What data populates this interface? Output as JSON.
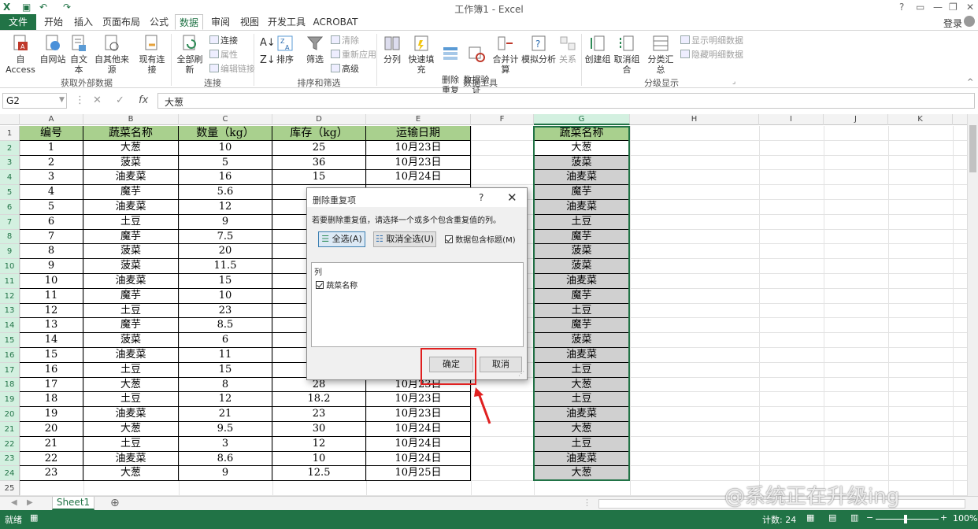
{
  "titlebar": {
    "title": "工作簿1 - Excel",
    "icons": [
      "excel-logo",
      "save-icon",
      "undo-icon",
      "redo-icon"
    ]
  },
  "tabs": {
    "file": "文件",
    "items": [
      "开始",
      "插入",
      "页面布局",
      "公式",
      "数据",
      "审阅",
      "视图",
      "开发工具",
      "ACROBAT"
    ],
    "active": "数据",
    "signin": "登录"
  },
  "ribbon": {
    "external": {
      "buttons": [
        "自 Access",
        "自网站",
        "自文本",
        "自其他来源",
        "现有连接"
      ],
      "group": "获取外部数据"
    },
    "connections": {
      "refresh": "全部刷新",
      "small": [
        "连接",
        "属性",
        "编辑链接"
      ],
      "group": "连接"
    },
    "sortfilter": {
      "sort": "排序",
      "filter": "筛选",
      "small": [
        "清除",
        "重新应用",
        "高级"
      ],
      "group": "排序和筛选"
    },
    "datatools": {
      "buttons": [
        "分列",
        "快速填充",
        "删除\n重复项",
        "数据验\n证",
        "合并计算",
        "模拟分析",
        "关系"
      ],
      "group": "数据工具"
    },
    "outline": {
      "buttons": [
        "创建组",
        "取消组合",
        "分类汇总"
      ],
      "small": [
        "显示明细数据",
        "隐藏明细数据"
      ],
      "group": "分级显示"
    }
  },
  "formula": {
    "namebox": "G2",
    "value": "大葱"
  },
  "columns": [
    "A",
    "B",
    "C",
    "D",
    "E",
    "F",
    "G",
    "H",
    "I",
    "J",
    "K"
  ],
  "table": {
    "headers": [
      "编号",
      "蔬菜名称",
      "数量（kg）",
      "库存（kg）",
      "运输日期"
    ],
    "rows": [
      [
        "1",
        "大葱",
        "10",
        "25",
        "10月23日"
      ],
      [
        "2",
        "菠菜",
        "5",
        "36",
        "10月23日"
      ],
      [
        "3",
        "油麦菜",
        "16",
        "15",
        "10月24日"
      ],
      [
        "4",
        "魔芋",
        "5.6",
        "",
        ""
      ],
      [
        "5",
        "油麦菜",
        "12",
        "",
        ""
      ],
      [
        "6",
        "土豆",
        "9",
        "",
        ""
      ],
      [
        "7",
        "魔芋",
        "7.5",
        "",
        ""
      ],
      [
        "8",
        "菠菜",
        "20",
        "",
        ""
      ],
      [
        "9",
        "菠菜",
        "11.5",
        "",
        ""
      ],
      [
        "10",
        "油麦菜",
        "15",
        "",
        ""
      ],
      [
        "11",
        "魔芋",
        "10",
        "",
        ""
      ],
      [
        "12",
        "土豆",
        "23",
        "",
        ""
      ],
      [
        "13",
        "魔芋",
        "8.5",
        "",
        ""
      ],
      [
        "14",
        "菠菜",
        "6",
        "",
        ""
      ],
      [
        "15",
        "油麦菜",
        "11",
        "",
        ""
      ],
      [
        "16",
        "土豆",
        "15",
        "",
        ""
      ],
      [
        "17",
        "大葱",
        "8",
        "28",
        "10月23日"
      ],
      [
        "18",
        "土豆",
        "12",
        "18.2",
        "10月23日"
      ],
      [
        "19",
        "油麦菜",
        "21",
        "23",
        "10月23日"
      ],
      [
        "20",
        "大葱",
        "9.5",
        "30",
        "10月24日"
      ],
      [
        "21",
        "土豆",
        "3",
        "12",
        "10月24日"
      ],
      [
        "22",
        "油麦菜",
        "8.6",
        "10",
        "10月24日"
      ],
      [
        "23",
        "大葱",
        "9",
        "12.5",
        "10月25日"
      ]
    ]
  },
  "colG": {
    "header": "蔬菜名称",
    "values": [
      "大葱",
      "菠菜",
      "油麦菜",
      "魔芋",
      "油麦菜",
      "土豆",
      "魔芋",
      "菠菜",
      "菠菜",
      "油麦菜",
      "魔芋",
      "土豆",
      "魔芋",
      "菠菜",
      "油麦菜",
      "土豆",
      "大葱",
      "土豆",
      "油麦菜",
      "大葱",
      "土豆",
      "油麦菜",
      "大葱"
    ]
  },
  "dialog": {
    "title": "删除重复项",
    "help": "?",
    "close": "✕",
    "description": "若要删除重复值，请选择一个或多个包含重复值的列。",
    "select_all": "全选(A)",
    "unselect_all": "取消全选(U)",
    "has_headers": "数据包含标题(M)",
    "list_header": "列",
    "item": "蔬菜名称",
    "ok": "确定",
    "cancel": "取消"
  },
  "sheet": {
    "name": "Sheet1"
  },
  "status": {
    "ready": "就绪",
    "count": "计数: 24",
    "zoom": "100%"
  },
  "watermark": "@系统正在升级ing",
  "colors": {
    "excel_green": "#217346",
    "header_fill": "#a9d08e",
    "selection_gray": "#d0d0d0",
    "annotation_red": "#e02020"
  }
}
